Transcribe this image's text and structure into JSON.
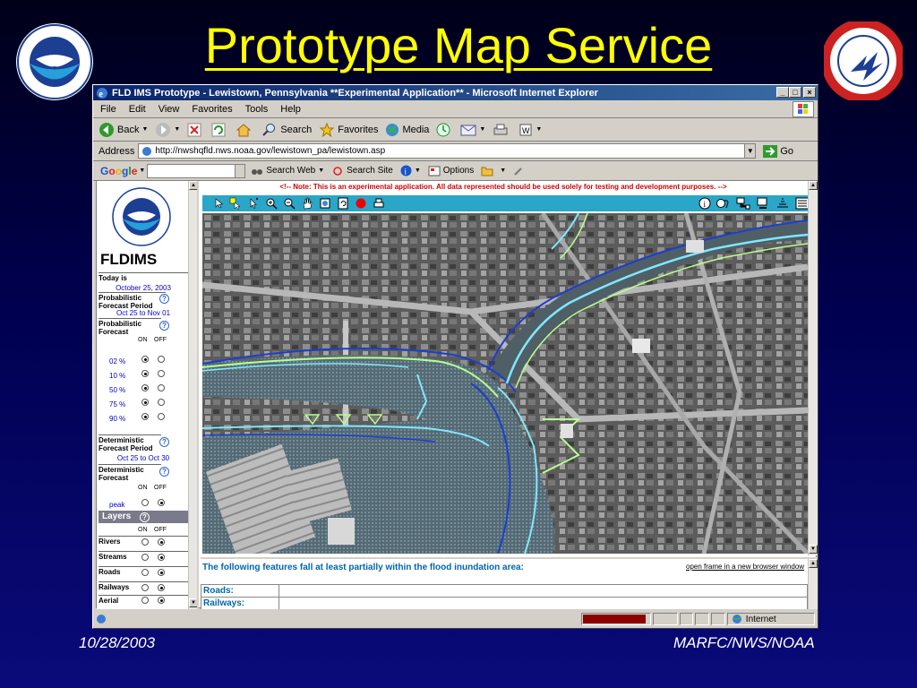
{
  "slide": {
    "title": "Prototype Map Service",
    "footer_left": "10/28/2003",
    "footer_right": "MARFC/NWS/NOAA"
  },
  "browser": {
    "title": "FLD IMS Prototype - Lewistown, Pennsylvania **Experimental Application** - Microsoft Internet Explorer",
    "menu": [
      "File",
      "Edit",
      "View",
      "Favorites",
      "Tools",
      "Help"
    ],
    "toolbar": {
      "back": "Back",
      "search": "Search",
      "favorites": "Favorites",
      "media": "Media"
    },
    "address_label": "Address",
    "url": "http://nwshqfld.nws.noaa.gov/lewistown_pa/lewistown.asp",
    "go_label": "Go",
    "google": {
      "logo": "Google",
      "search_web": "Search Web",
      "search_site": "Search Site",
      "options": "Options"
    },
    "status": {
      "zone": "Internet",
      "progress_fraction": 0.95
    }
  },
  "left_panel": {
    "title": "FLDIMS",
    "today_label": "Today is",
    "today_value": "October 25, 2003",
    "prob_period_label": "Probabilistic Forecast Period",
    "prob_period_value": "Oct 25 to Nov 01",
    "prob_forecast_label": "Probabilistic Forecast",
    "on_label": "ON",
    "off_label": "OFF",
    "percents": [
      "02 %",
      "10 %",
      "50 %",
      "75 %",
      "90 %"
    ],
    "det_period_label": "Deterministic Forecast Period",
    "det_period_value": "Oct 25 to Oct 30",
    "det_forecast_label": "Deterministic Forecast",
    "peak_label": "peak",
    "layers_label": "Layers",
    "layers": [
      "Rivers",
      "Streams",
      "Roads",
      "Railways",
      "Aerial"
    ]
  },
  "map_frame": {
    "notice": "<!-- Note: This is an experimental application. All data represented should be used solely for testing and development purposes. -->"
  },
  "features": {
    "title": "The following features fall at least partially within the flood inundation area:",
    "link": "open frame in a new browser window",
    "rows": [
      "Roads:",
      "Railways:"
    ]
  },
  "colors": {
    "title_yellow": "#ffff00",
    "map_toolbar": "#2aa6c8",
    "flood_blue": "#1a3fd0",
    "flood_cyan": "#7fe8ff",
    "flood_green": "#b8ff90"
  }
}
